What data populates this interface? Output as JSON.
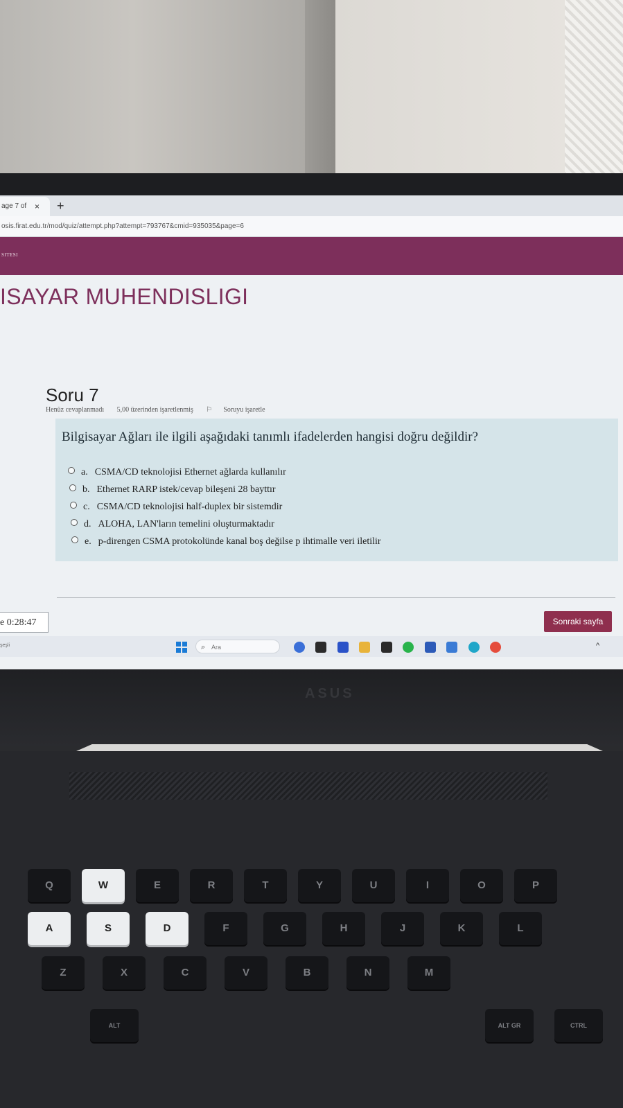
{
  "browser": {
    "tab_title": "age 7 of",
    "tab_close": "×",
    "new_tab": "+",
    "url": "osis.firat.edu.tr/mod/quiz/attempt.php?attempt=793767&cmid=935035&page=6"
  },
  "site": {
    "band_text": "SITESI",
    "department": "ISAYAR MUHENDISLIGI",
    "accent_color": "#7d2f5b"
  },
  "question": {
    "heading": "Soru 7",
    "status": "Henüz cevaplanmadı",
    "marks": "5,00 üzerinden işaretlenmiş",
    "flag_label": "Soruyu işaretle",
    "text": "Bilgisayar Ağları ile ilgili aşağıdaki tanımlı ifadelerden hangisi doğru değildir?",
    "options": [
      {
        "letter": "a.",
        "text": "CSMA/CD teknolojisi Ethernet ağlarda kullanılır"
      },
      {
        "letter": "b.",
        "text": "Ethernet RARP istek/cevap bileşeni 28 bayttır"
      },
      {
        "letter": "c.",
        "text": "CSMA/CD teknolojisi half-duplex bir sistemdir"
      },
      {
        "letter": "d.",
        "text": "ALOHA, LAN'ların temelini oluşturmaktadır"
      },
      {
        "letter": "e.",
        "text": "p-direngen CSMA protokolünde kanal boş değilse p ihtimalle veri iletilir"
      }
    ]
  },
  "timer": {
    "text": "e 0:28:47"
  },
  "navigation": {
    "next_label": "Sonraki sayfa"
  },
  "taskbar": {
    "left_text": "şeşli",
    "search_placeholder": "Ara",
    "right_text": "^"
  },
  "keyboard": {
    "keys": [
      "Q",
      "W",
      "E",
      "R",
      "T",
      "Y",
      "U",
      "I",
      "O",
      "P",
      "A",
      "S",
      "D",
      "F",
      "G",
      "H",
      "J",
      "K",
      "L",
      "Z",
      "X",
      "C",
      "V",
      "B",
      "N",
      "M",
      "ALT",
      "ALT GR",
      "CTRL"
    ],
    "lit_keys": [
      "W",
      "A",
      "S",
      "D"
    ]
  }
}
